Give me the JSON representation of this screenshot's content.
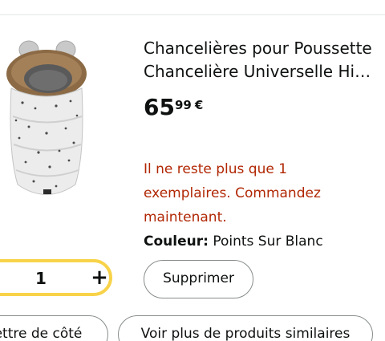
{
  "product": {
    "title_line1": "Chancelières pour Poussette",
    "title_line2": "Chancelière Universelle Hi…",
    "price_whole": "65",
    "price_fraction": "99",
    "price_currency": "€",
    "stock_warning": "Il ne reste plus que 1 exemplaires. Commandez maintenant.",
    "color_label": "Couleur:",
    "color_value": "Points Sur Blanc",
    "image_icon": "footmuff-product-image"
  },
  "quantity": {
    "value": "1",
    "plus_symbol": "+"
  },
  "actions": {
    "delete_label": "Supprimer",
    "save_for_later_label": "ettre de côté",
    "see_similar_label": "Voir plus de produits similaires"
  },
  "colors": {
    "stock_warning": "#b12704",
    "stepper_border": "#f8d349",
    "text": "#0f1111",
    "button_border": "#888c8c"
  }
}
